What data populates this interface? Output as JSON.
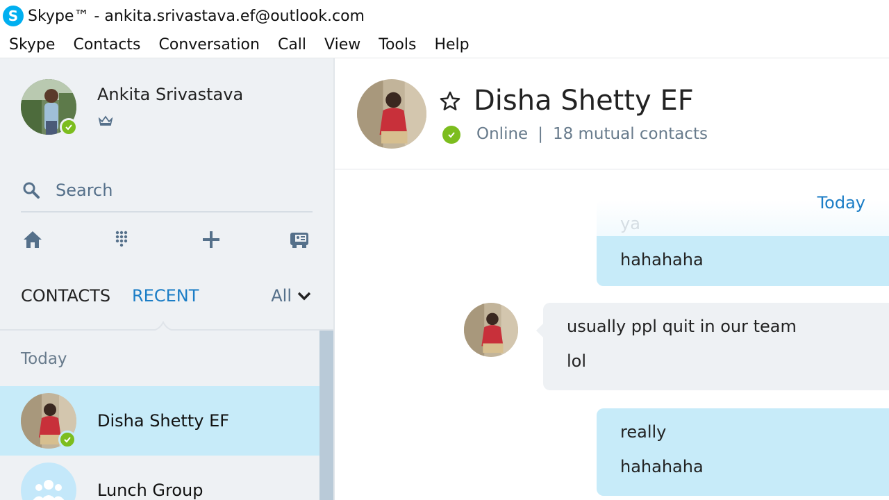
{
  "window": {
    "title": "Skype™ - ankita.srivastava.ef@outlook.com"
  },
  "menu": [
    "Skype",
    "Contacts",
    "Conversation",
    "Call",
    "View",
    "Tools",
    "Help"
  ],
  "profile": {
    "name": "Ankita Srivastava",
    "status": "online"
  },
  "search": {
    "placeholder": "Search"
  },
  "toolbar": {
    "icons": [
      "home-icon",
      "dialpad-icon",
      "add-icon",
      "contact-card-icon"
    ]
  },
  "tabs": {
    "contacts": "CONTACTS",
    "recent": "RECENT",
    "active": "recent",
    "filter": "All"
  },
  "recent": {
    "section": "Today",
    "items": [
      {
        "name": "Disha Shetty EF",
        "status": "online",
        "active": true
      },
      {
        "name": "Lunch Group",
        "status": "",
        "active": false
      }
    ]
  },
  "conversation": {
    "name": "Disha Shetty EF",
    "status": "Online",
    "separator": "|",
    "mutual": "18 mutual contacts",
    "day_label": "Today",
    "messages": {
      "faded": "ya",
      "outgoing_1": [
        "hahahaha"
      ],
      "incoming_1": [
        "usually ppl quit in our team",
        "lol"
      ],
      "outgoing_2": [
        "really",
        "hahahaha"
      ]
    }
  },
  "colors": {
    "skype_blue": "#00aff0",
    "accent": "#1b7dc6",
    "online": "#7cbd1e",
    "outgoing_bubble": "#c7ebf9",
    "incoming_bubble": "#eef1f4",
    "sidebar_bg": "#eef1f4"
  }
}
